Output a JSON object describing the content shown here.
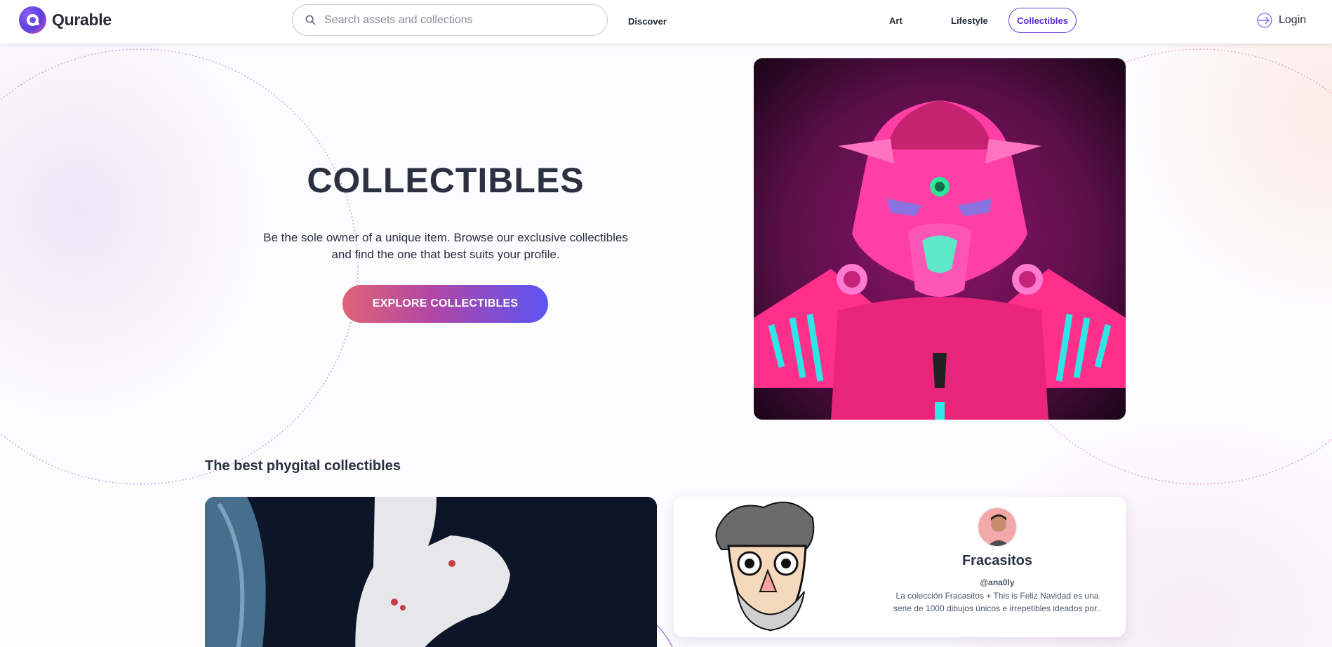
{
  "brand": {
    "name": "Qurable"
  },
  "search": {
    "placeholder": "Search assets and collections"
  },
  "nav": {
    "discover": "Discover",
    "art": "Art",
    "lifestyle": "Lifestyle",
    "collectibles": "Collectibles",
    "login": "Login"
  },
  "hero": {
    "title": "COLLECTIBLES",
    "description": "Be the sole owner of a unique item. Browse our exclusive collectibles and find the one that best suits your profile.",
    "cta": "EXPLORE COLLECTIBLES"
  },
  "phygital": {
    "title": "The best phygital collectibles",
    "featured": {
      "name": "Fracasitos",
      "handle": "@ana0ly",
      "description": "La colección Fracasitos + This is Feliz Navidad es una serie de 1000 dibujos únicos e irrepetibles ideados por.."
    }
  },
  "colors": {
    "accent": "#5b2ed6",
    "cta_start": "#e06377",
    "cta_end": "#5b55f2"
  }
}
